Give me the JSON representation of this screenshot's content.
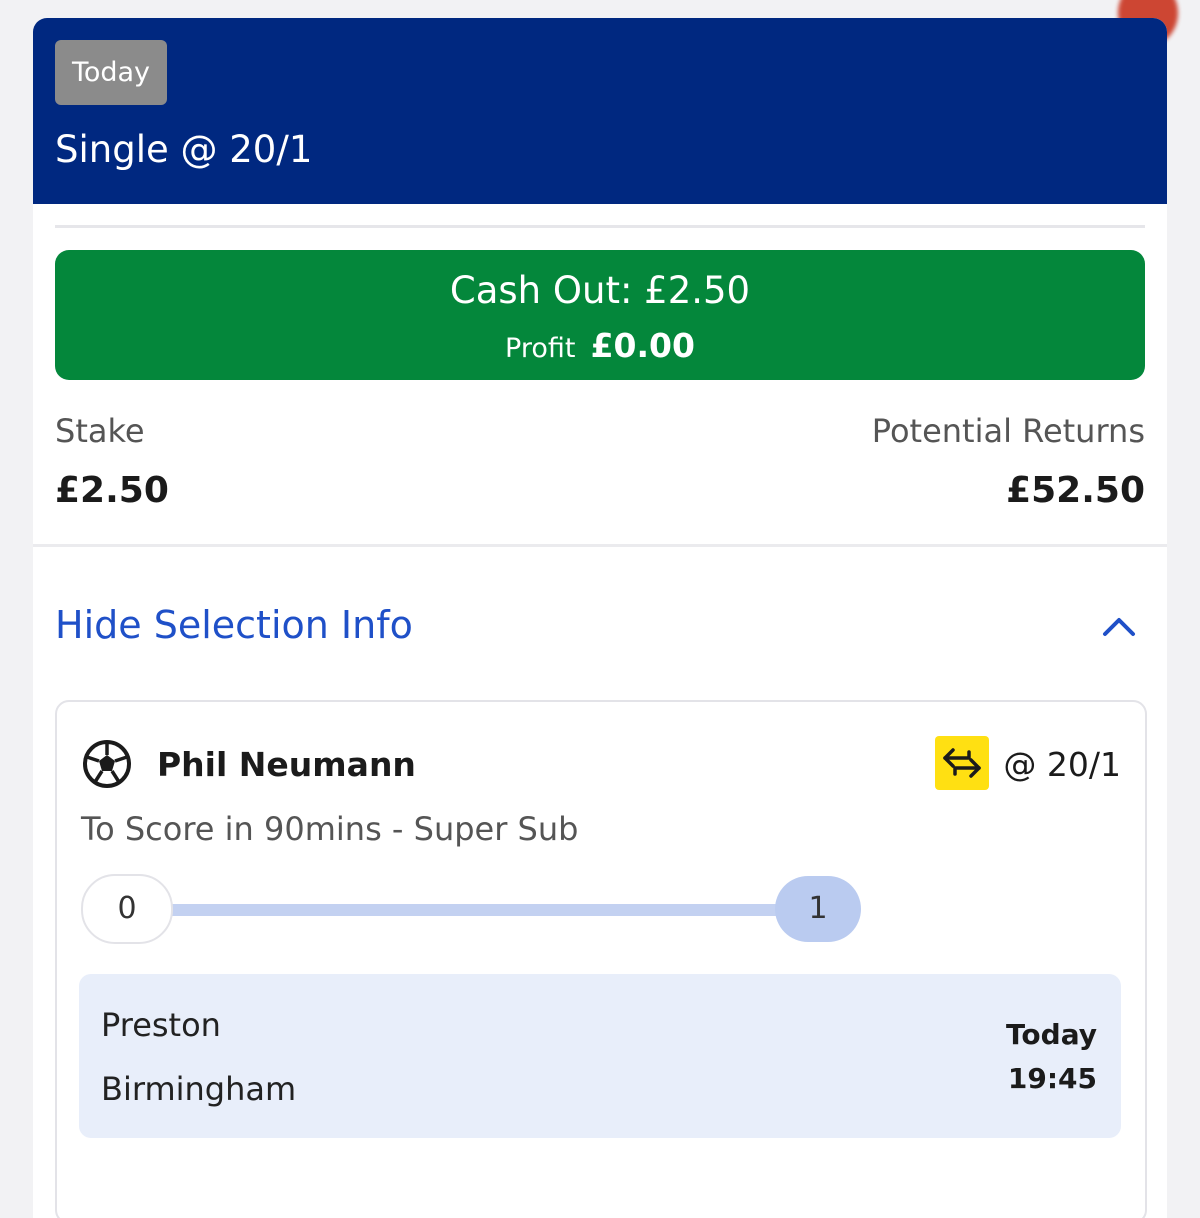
{
  "bet": {
    "day_badge": "Today",
    "title": "Single @ 20/1"
  },
  "cash_out": {
    "label": "Cash Out: £2.50",
    "profit_label": "Profit",
    "profit_value": "£0.00",
    "color": "#04873b"
  },
  "stake": {
    "label": "Stake",
    "value": "£2.50"
  },
  "potential_returns": {
    "label": "Potential Returns",
    "value": "£52.50"
  },
  "selection_info": {
    "toggle_label": "Hide Selection Info",
    "toggle_icon": "chevron-up-icon"
  },
  "selection": {
    "sport_icon": "football-icon",
    "player": "Phil Neumann",
    "swap_icon": "swap-arrows-icon",
    "odds": "@ 20/1",
    "market": "To Score in 90mins - Super Sub",
    "progress": {
      "start": "0",
      "end": "1",
      "fraction": 1.0
    },
    "event": {
      "home": "Preston",
      "away": "Birmingham",
      "day": "Today",
      "time": "19:45"
    }
  },
  "colors": {
    "header_bg": "#002880",
    "link": "#1f50c8",
    "swap_bg": "#ffe012",
    "progress": "#c3d1f1"
  }
}
